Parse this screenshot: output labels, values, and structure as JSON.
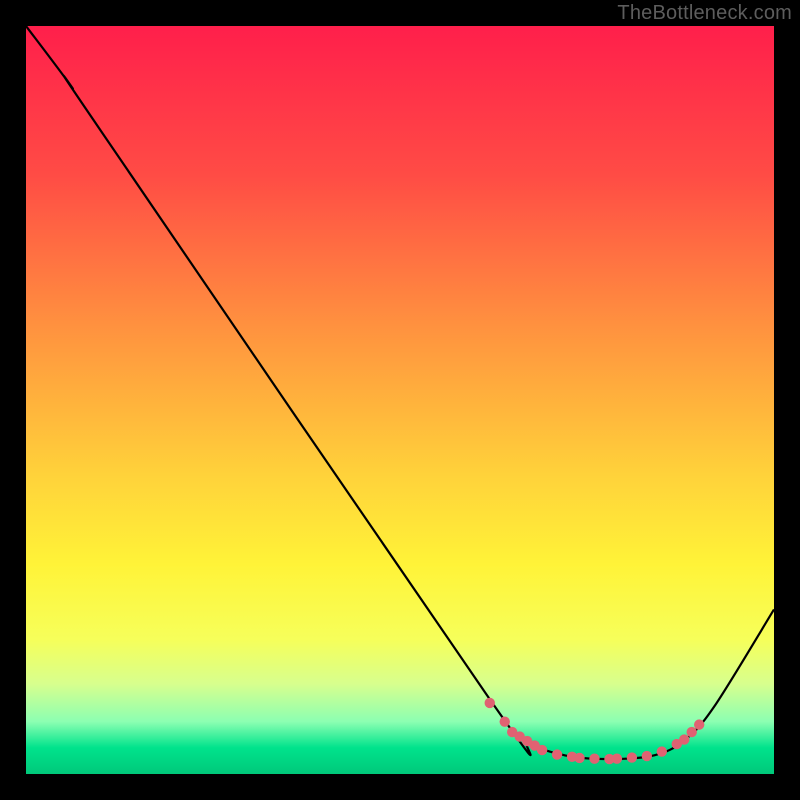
{
  "watermark": "TheBottleneck.com",
  "chart_data": {
    "type": "line",
    "title": "",
    "xlabel": "",
    "ylabel": "",
    "xlim": [
      0,
      100
    ],
    "ylim": [
      0,
      100
    ],
    "gradient_stops": [
      {
        "offset": 0.0,
        "color": "#ff1f4b"
      },
      {
        "offset": 0.2,
        "color": "#ff4c45"
      },
      {
        "offset": 0.4,
        "color": "#ff913f"
      },
      {
        "offset": 0.6,
        "color": "#ffd23a"
      },
      {
        "offset": 0.72,
        "color": "#fff338"
      },
      {
        "offset": 0.82,
        "color": "#f6ff5a"
      },
      {
        "offset": 0.88,
        "color": "#d7ff8e"
      },
      {
        "offset": 0.93,
        "color": "#8cffb2"
      },
      {
        "offset": 0.965,
        "color": "#00e38c"
      },
      {
        "offset": 1.0,
        "color": "#00c87a"
      }
    ],
    "bottleneck_curve": [
      {
        "x": 0,
        "y": 100
      },
      {
        "x": 6,
        "y": 92
      },
      {
        "x": 10,
        "y": 86
      },
      {
        "x": 62,
        "y": 10
      },
      {
        "x": 67,
        "y": 4.5
      },
      {
        "x": 72,
        "y": 2.5
      },
      {
        "x": 78,
        "y": 2.0
      },
      {
        "x": 84,
        "y": 2.5
      },
      {
        "x": 88,
        "y": 4.5
      },
      {
        "x": 92,
        "y": 9
      },
      {
        "x": 100,
        "y": 22
      }
    ],
    "marker_points": [
      {
        "x": 62,
        "y": 9.5
      },
      {
        "x": 64,
        "y": 7.0
      },
      {
        "x": 65,
        "y": 5.6
      },
      {
        "x": 66,
        "y": 5.0
      },
      {
        "x": 67,
        "y": 4.4
      },
      {
        "x": 68,
        "y": 3.8
      },
      {
        "x": 69,
        "y": 3.2
      },
      {
        "x": 71,
        "y": 2.6
      },
      {
        "x": 73,
        "y": 2.3
      },
      {
        "x": 74,
        "y": 2.15
      },
      {
        "x": 76,
        "y": 2.05
      },
      {
        "x": 78,
        "y": 2.0
      },
      {
        "x": 79,
        "y": 2.05
      },
      {
        "x": 81,
        "y": 2.2
      },
      {
        "x": 83,
        "y": 2.4
      },
      {
        "x": 85,
        "y": 3.0
      },
      {
        "x": 87,
        "y": 4.0
      },
      {
        "x": 88,
        "y": 4.6
      },
      {
        "x": 89,
        "y": 5.6
      },
      {
        "x": 90,
        "y": 6.6
      }
    ],
    "marker_color": "#e06272",
    "curve_color": "#000000"
  }
}
